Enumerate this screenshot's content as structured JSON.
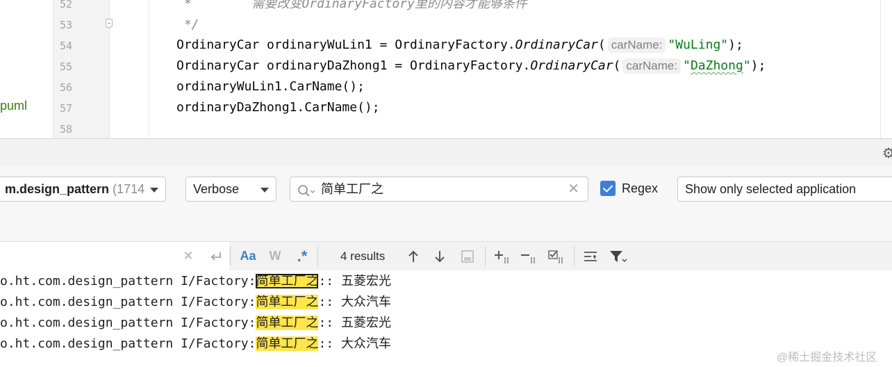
{
  "editor": {
    "project_label": "puml",
    "line_numbers": [
      "52",
      "53",
      "54",
      "55",
      "56",
      "57",
      "58"
    ],
    "line52_comment": " *        需要改变OrdinaryFactory里的内容才能够条件",
    "line53_comment": " */",
    "line54": {
      "prefix": "OrdinaryCar ordinaryWuLin1 = OrdinaryFactory.",
      "method": "OrdinaryCar",
      "open": "(",
      "hint": "carName:",
      "string": "\"WuLing\"",
      "suffix": ");"
    },
    "line55": {
      "prefix": "OrdinaryCar ordinaryDaZhong1 = OrdinaryFactory.",
      "method": "OrdinaryCar",
      "open": "(",
      "hint": "carName:",
      "string_open": "\"",
      "string_word": "DaZhong",
      "string_close": "\"",
      "suffix": ");"
    },
    "line56": "ordinaryWuLin1.CarName();",
    "line57": "ordinaryDaZhong1.CarName();"
  },
  "logcat": {
    "process_bold": "m.design_pattern",
    "process_count": "(1714",
    "log_level": "Verbose",
    "search_value": "简单工厂之",
    "regex_label": "Regex",
    "regex_checked": true,
    "app_filter": "Show only selected application",
    "find_toolbar": {
      "match_case": "Aa",
      "words": "W",
      "regex": ".*",
      "results": "4 results"
    },
    "log_rows": [
      {
        "prefix": "o.ht.com.design_pattern I/Factory:",
        "match": "简单工厂之",
        "suffix": ":: 五菱宏光"
      },
      {
        "prefix": "o.ht.com.design_pattern I/Factory:",
        "match": "简单工厂之",
        "suffix": ":: 大众汽车"
      },
      {
        "prefix": "o.ht.com.design_pattern I/Factory:",
        "match": "简单工厂之",
        "suffix": ":: 五菱宏光"
      },
      {
        "prefix": "o.ht.com.design_pattern I/Factory:",
        "match": "简单工厂之",
        "suffix": ":: 大众汽车"
      }
    ]
  },
  "watermark": "@稀土掘金技术社区",
  "icons": {
    "gear": "gear-icon",
    "search": "search-icon",
    "clear": "clear-icon",
    "wrap": "wrap-icon",
    "prev": "arrow-up-icon",
    "next": "arrow-down-icon",
    "select_all": "select-all-icon",
    "add_occurrence": "add-occurrence-icon",
    "remove_occurrence": "remove-occurrence-icon",
    "select_all_occurrences": "select-all-occurrences-icon",
    "options": "options-icon",
    "filter": "filter-icon"
  },
  "colors": {
    "highlight": "#fde54a",
    "accent": "#3c7fd8",
    "string": "#067d17",
    "comment": "#8c8c8c"
  }
}
